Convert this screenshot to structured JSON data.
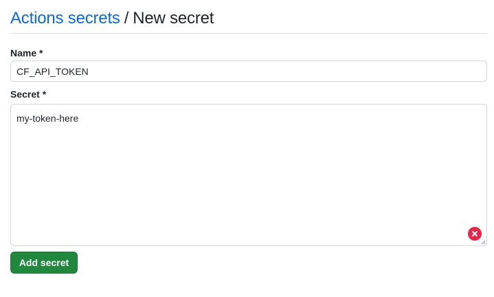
{
  "breadcrumb": {
    "parent_label": "Actions secrets",
    "separator": "/",
    "current_label": "New secret"
  },
  "form": {
    "name": {
      "label": "Name *",
      "value": "CF_API_TOKEN"
    },
    "secret": {
      "label": "Secret *",
      "value": "my-token-here",
      "clear_icon": "x-circle-icon"
    },
    "submit_label": "Add secret"
  },
  "colors": {
    "link": "#0969da",
    "primary_button": "#1f883d",
    "clear_icon": "#e5254a",
    "border": "#d0d7de"
  }
}
